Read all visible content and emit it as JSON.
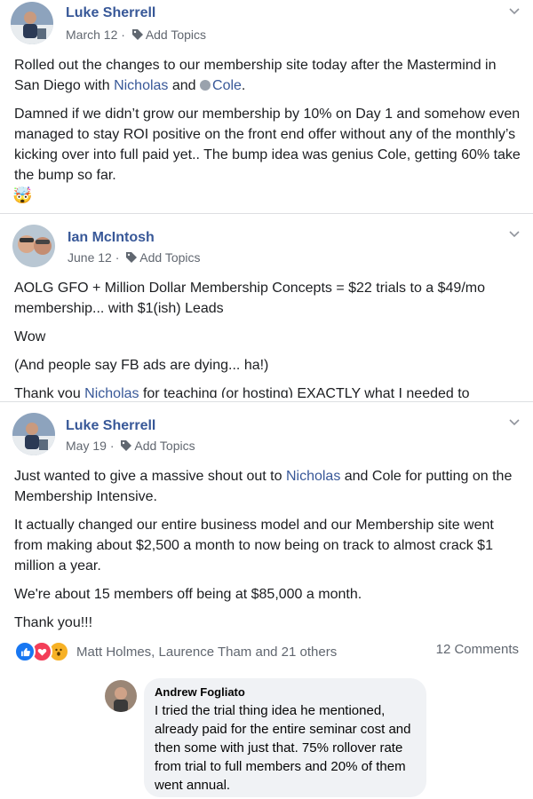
{
  "posts": [
    {
      "author": "Luke Sherrell",
      "date": "March 12",
      "sep": "·",
      "add_topics": "Add Topics",
      "p1_text": "Rolled out the changes to our membership site today after the Mastermind in San Diego with ",
      "p1_mention1": "Nicholas",
      "p1_and": " and ",
      "p1_mention2": "Cole",
      "p1_end": ".",
      "p2": "Damned if we didn’t grow our membership by 10% on Day 1 and somehow even managed to stay ROI positive on the front end offer without any of the monthly’s kicking over into full paid yet.. The bump idea was genius Cole, getting 60% take the bump so far.",
      "emoji": "🤯"
    },
    {
      "author": "Ian McIntosh",
      "date": "June 12",
      "sep": "·",
      "add_topics": "Add Topics",
      "p1": "AOLG GFO + Million Dollar Membership Concepts = $22 trials to a $49/mo membership... with $1(ish) Leads",
      "p2": "Wow",
      "p3": "(And people say FB ads are dying... ha!)",
      "p4_start": "Thank you ",
      "p4_mention": "Nicholas",
      "p4_end": " for teaching (or hosting) EXACTLY what I needed to"
    },
    {
      "author": "Luke Sherrell",
      "date": "May 19",
      "sep": "·",
      "add_topics": "Add Topics",
      "p1_start": "Just wanted to give a massive shout out to ",
      "p1_mention": "Nicholas",
      "p1_end": " and Cole for putting on the Membership Intensive.",
      "p2": "It actually changed our entire business model and our Membership site went from making about $2,500 a month to now being on track to almost crack $1 million a year.",
      "p3": "We're about 15 members off being at $85,000 a month.",
      "p4": "Thank you!!!",
      "reactions_text": "Matt Holmes, Laurence Tham and 21 others",
      "comments_count": "12 Comments"
    }
  ],
  "comment": {
    "author": "Andrew Fogliato",
    "text": "I tried the trial thing idea he mentioned, already paid for the entire seminar cost and then some with just that. 75% rollover rate from trial to full members and 20% of them went annual."
  },
  "colors": {
    "link": "#385898",
    "like": "#1877f2",
    "love": "#f33e58",
    "wow": "#f7b125"
  }
}
